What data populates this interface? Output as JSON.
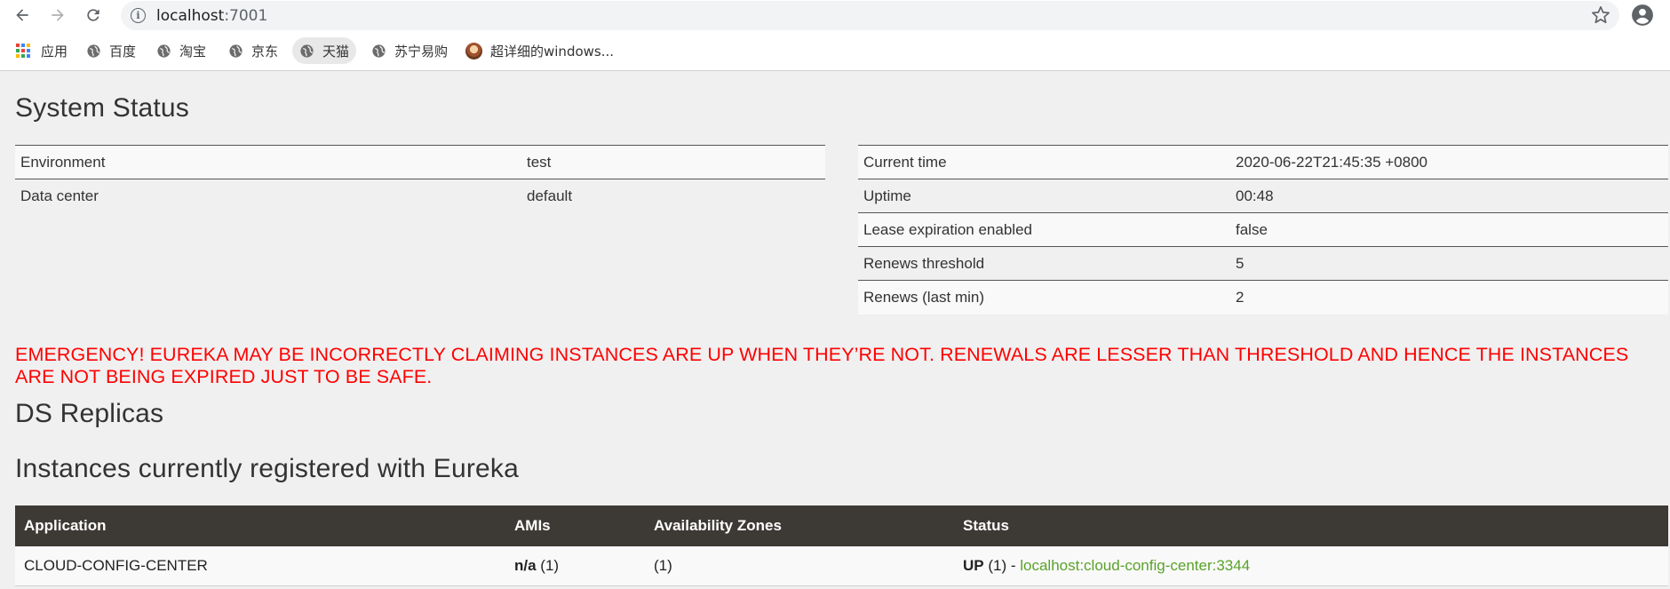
{
  "browser": {
    "url_host": "localhost",
    "url_port": ":7001",
    "bookmarks": [
      {
        "label": "应用",
        "icon": "apps-grid-icon"
      },
      {
        "label": "百度",
        "icon": "globe-icon"
      },
      {
        "label": "淘宝",
        "icon": "globe-icon"
      },
      {
        "label": "京东",
        "icon": "globe-icon"
      },
      {
        "label": "天猫",
        "icon": "globe-icon"
      },
      {
        "label": "苏宁易购",
        "icon": "globe-icon"
      },
      {
        "label": "超详细的windows...",
        "icon": "avatar-favicon"
      }
    ]
  },
  "system_status": {
    "title": "System Status",
    "left": [
      {
        "key": "Environment",
        "value": "test"
      },
      {
        "key": "Data center",
        "value": "default"
      }
    ],
    "right": [
      {
        "key": "Current time",
        "value": "2020-06-22T21:45:35 +0800"
      },
      {
        "key": "Uptime",
        "value": "00:48"
      },
      {
        "key": "Lease expiration enabled",
        "value": "false"
      },
      {
        "key": "Renews threshold",
        "value": "5"
      },
      {
        "key": "Renews (last min)",
        "value": "2"
      }
    ]
  },
  "emergency": "EMERGENCY! EUREKA MAY BE INCORRECTLY CLAIMING INSTANCES ARE UP WHEN THEY’RE NOT. RENEWALS ARE LESSER THAN THRESHOLD AND HENCE THE INSTANCES ARE NOT BEING EXPIRED JUST TO BE SAFE.",
  "ds_replicas": {
    "title": "DS Replicas"
  },
  "instances": {
    "title": "Instances currently registered with Eureka",
    "headers": [
      "Application",
      "AMIs",
      "Availability Zones",
      "Status"
    ],
    "rows": [
      {
        "application": "CLOUD-CONFIG-CENTER",
        "amis_bold": "n/a",
        "amis_count": " (1)",
        "zones": "(1)",
        "status_bold": "UP",
        "status_count": " (1) - ",
        "status_link": "localhost:cloud-config-center:3344"
      }
    ]
  },
  "colors": {
    "emergency": "#ff0000",
    "table_header": "#3d3934",
    "link": "#5aa22a"
  }
}
